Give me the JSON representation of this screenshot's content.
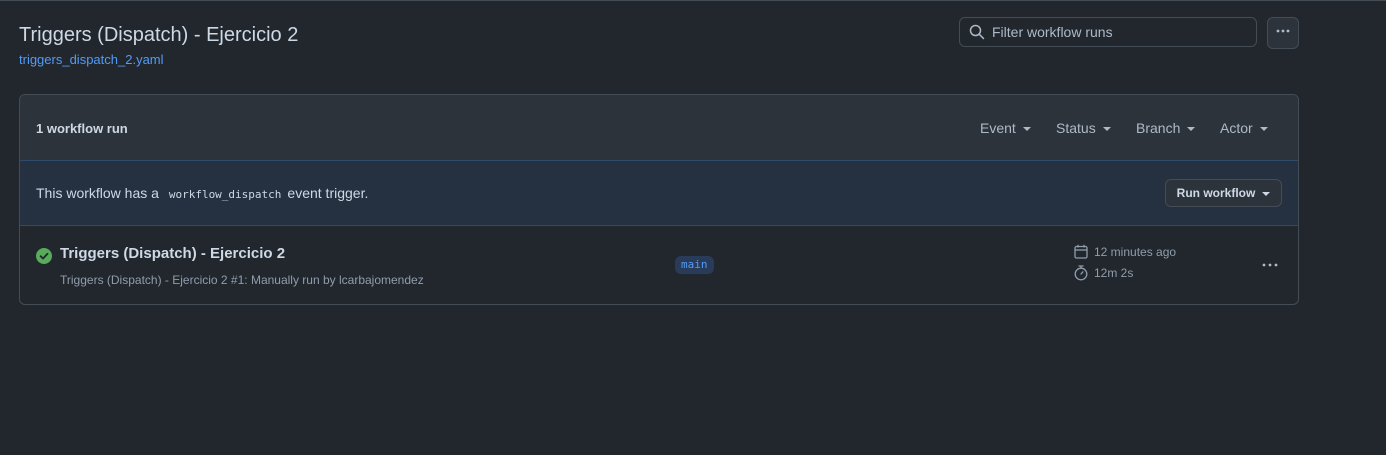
{
  "header": {
    "title": "Triggers (Dispatch) - Ejercicio 2",
    "file_link": "triggers_dispatch_2.yaml"
  },
  "search": {
    "placeholder": "Filter workflow runs",
    "value": ""
  },
  "panel": {
    "run_count": "1 workflow run",
    "filters": [
      "Event",
      "Status",
      "Branch",
      "Actor"
    ]
  },
  "dispatch": {
    "text_before": "This workflow has a",
    "code": "workflow_dispatch",
    "text_after": "event trigger.",
    "button_label": "Run workflow"
  },
  "runs": [
    {
      "title": "Triggers (Dispatch) - Ejercicio 2",
      "meta": "Triggers (Dispatch) - Ejercicio 2 #1: Manually run by lcarbajomendez",
      "branch": "main",
      "time_ago": "12 minutes ago",
      "duration": "12m 2s",
      "status": "success"
    }
  ],
  "colors": {
    "background": "#22272e",
    "accent_link": "#539bf5",
    "success": "#57ab5a"
  },
  "icons": {
    "search": "search-icon",
    "more": "kebab-horizontal-icon",
    "success": "check-circle-fill-icon",
    "calendar": "calendar-icon",
    "stopwatch": "stopwatch-icon"
  }
}
